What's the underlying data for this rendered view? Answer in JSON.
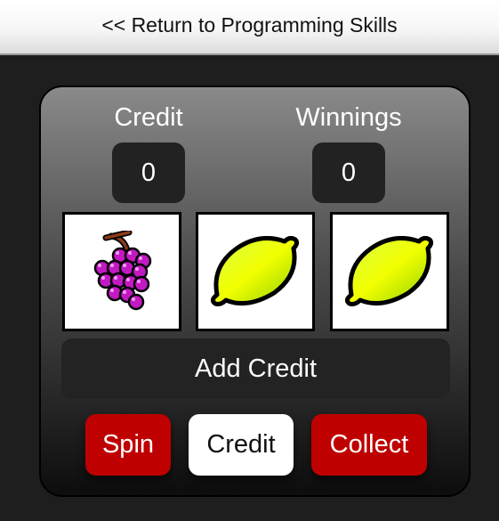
{
  "nav": {
    "return_link": "<< Return to Programming Skills"
  },
  "stats": {
    "credit_label": "Credit",
    "credit_value": "0",
    "winnings_label": "Winnings",
    "winnings_value": "0"
  },
  "reels": [
    {
      "symbol": "grapes-icon"
    },
    {
      "symbol": "lemon-icon"
    },
    {
      "symbol": "lemon-icon"
    }
  ],
  "controls": {
    "add_credit_label": "Add Credit",
    "spin_label": "Spin",
    "credit_label": "Credit",
    "collect_label": "Collect"
  },
  "colors": {
    "button_red": "#bf0000",
    "panel_dark": "#222222",
    "page_background": "#1e1e1e"
  }
}
